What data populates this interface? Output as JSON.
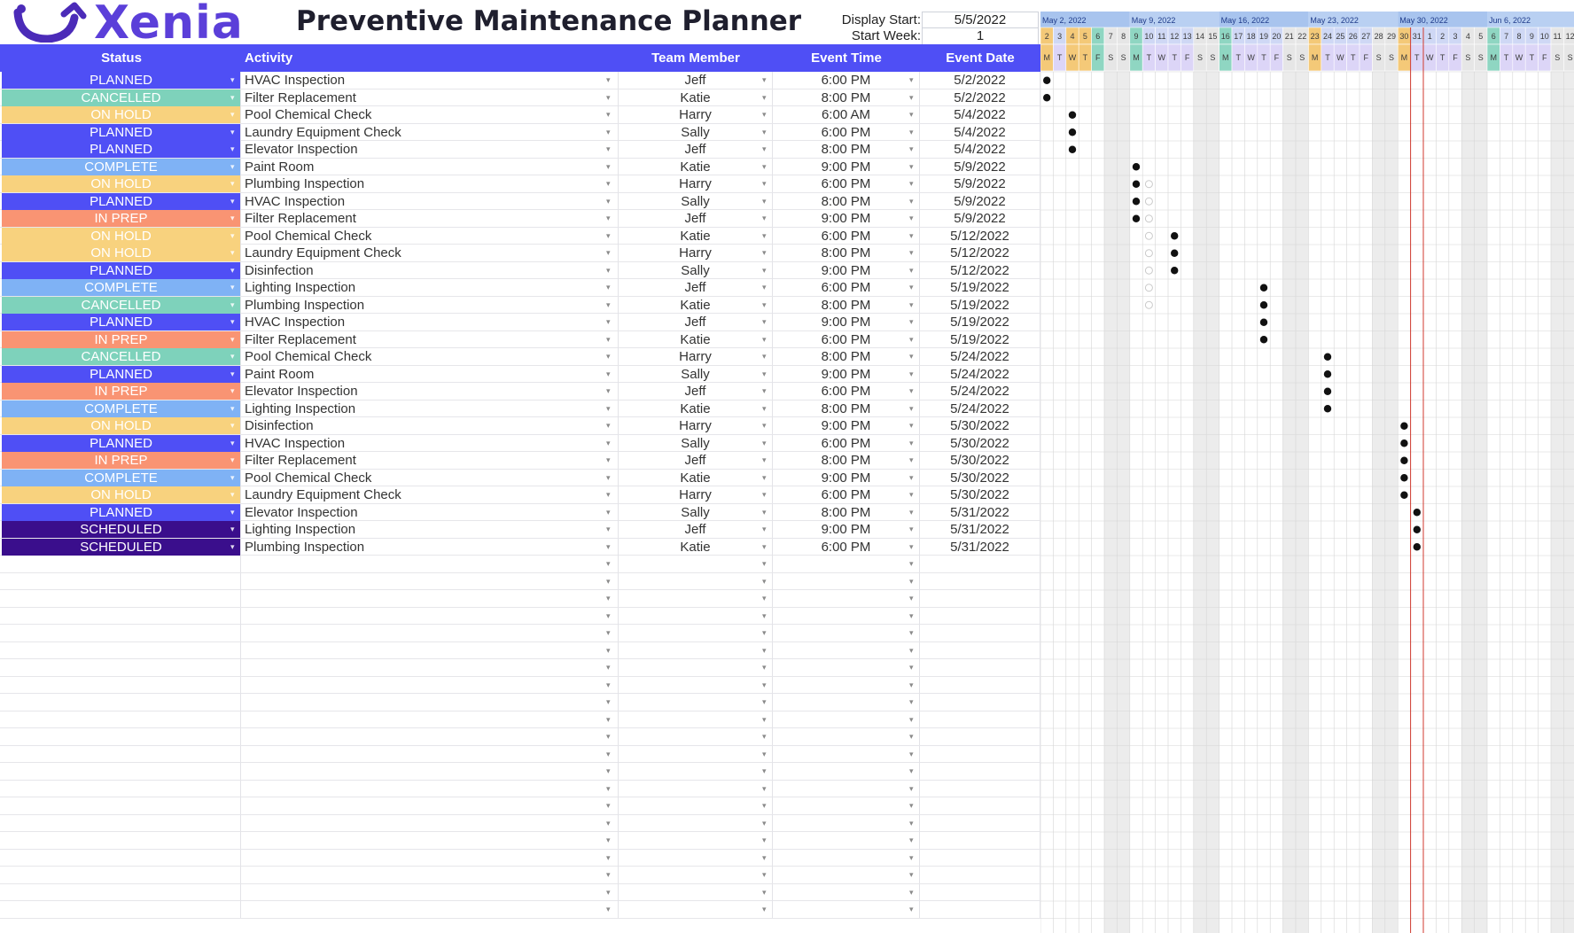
{
  "app": {
    "brand": "Xenia",
    "title": "Preventive Maintenance Planner",
    "display_start_label": "Display Start:",
    "display_start_value": "5/5/2022",
    "start_week_label": "Start Week:",
    "start_week_value": "1"
  },
  "columns": {
    "status": "Status",
    "activity": "Activity",
    "team_member": "Team Member",
    "event_time": "Event Time",
    "event_date": "Event Date"
  },
  "status_colors": {
    "PLANNED": "#4f4ff5",
    "CANCELLED": "#7ed2bb",
    "ON HOLD": "#f8d27e",
    "COMPLETE": "#7fb2f5",
    "IN PREP": "#f99473",
    "SCHEDULED": "#3a0e8c"
  },
  "rows": [
    {
      "status": "PLANNED",
      "activity": "HVAC Inspection",
      "member": "Jeff",
      "time": "6:00 PM",
      "date": "5/2/2022"
    },
    {
      "status": "CANCELLED",
      "activity": "Filter Replacement",
      "member": "Katie",
      "time": "8:00 PM",
      "date": "5/2/2022"
    },
    {
      "status": "ON HOLD",
      "activity": "Pool Chemical Check",
      "member": "Harry",
      "time": "6:00 AM",
      "date": "5/4/2022"
    },
    {
      "status": "PLANNED",
      "activity": "Laundry Equipment Check",
      "member": "Sally",
      "time": "6:00 PM",
      "date": "5/4/2022"
    },
    {
      "status": "PLANNED",
      "activity": "Elevator Inspection",
      "member": "Jeff",
      "time": "8:00 PM",
      "date": "5/4/2022"
    },
    {
      "status": "COMPLETE",
      "activity": "Paint Room",
      "member": "Katie",
      "time": "9:00 PM",
      "date": "5/9/2022"
    },
    {
      "status": "ON HOLD",
      "activity": "Plumbing Inspection",
      "member": "Harry",
      "time": "6:00 PM",
      "date": "5/9/2022"
    },
    {
      "status": "PLANNED",
      "activity": "HVAC Inspection",
      "member": "Sally",
      "time": "8:00 PM",
      "date": "5/9/2022"
    },
    {
      "status": "IN PREP",
      "activity": "Filter Replacement",
      "member": "Jeff",
      "time": "9:00 PM",
      "date": "5/9/2022"
    },
    {
      "status": "ON HOLD",
      "activity": "Pool Chemical Check",
      "member": "Katie",
      "time": "6:00 PM",
      "date": "5/12/2022"
    },
    {
      "status": "ON HOLD",
      "activity": "Laundry Equipment Check",
      "member": "Harry",
      "time": "8:00 PM",
      "date": "5/12/2022"
    },
    {
      "status": "PLANNED",
      "activity": "Disinfection",
      "member": "Sally",
      "time": "9:00 PM",
      "date": "5/12/2022"
    },
    {
      "status": "COMPLETE",
      "activity": "Lighting Inspection",
      "member": "Jeff",
      "time": "6:00 PM",
      "date": "5/19/2022"
    },
    {
      "status": "CANCELLED",
      "activity": "Plumbing Inspection",
      "member": "Katie",
      "time": "8:00 PM",
      "date": "5/19/2022"
    },
    {
      "status": "PLANNED",
      "activity": "HVAC Inspection",
      "member": "Jeff",
      "time": "9:00 PM",
      "date": "5/19/2022"
    },
    {
      "status": "IN PREP",
      "activity": "Filter Replacement",
      "member": "Katie",
      "time": "6:00 PM",
      "date": "5/19/2022"
    },
    {
      "status": "CANCELLED",
      "activity": "Pool Chemical Check",
      "member": "Harry",
      "time": "8:00 PM",
      "date": "5/24/2022"
    },
    {
      "status": "PLANNED",
      "activity": "Paint Room",
      "member": "Sally",
      "time": "9:00 PM",
      "date": "5/24/2022"
    },
    {
      "status": "IN PREP",
      "activity": "Elevator Inspection",
      "member": "Jeff",
      "time": "6:00 PM",
      "date": "5/24/2022"
    },
    {
      "status": "COMPLETE",
      "activity": "Lighting Inspection",
      "member": "Katie",
      "time": "8:00 PM",
      "date": "5/24/2022"
    },
    {
      "status": "ON HOLD",
      "activity": "Disinfection",
      "member": "Harry",
      "time": "9:00 PM",
      "date": "5/30/2022"
    },
    {
      "status": "PLANNED",
      "activity": "HVAC Inspection",
      "member": "Sally",
      "time": "6:00 PM",
      "date": "5/30/2022"
    },
    {
      "status": "IN PREP",
      "activity": "Filter Replacement",
      "member": "Jeff",
      "time": "8:00 PM",
      "date": "5/30/2022"
    },
    {
      "status": "COMPLETE",
      "activity": "Pool Chemical Check",
      "member": "Katie",
      "time": "9:00 PM",
      "date": "5/30/2022"
    },
    {
      "status": "ON HOLD",
      "activity": "Laundry Equipment Check",
      "member": "Harry",
      "time": "6:00 PM",
      "date": "5/30/2022"
    },
    {
      "status": "PLANNED",
      "activity": "Elevator Inspection",
      "member": "Sally",
      "time": "8:00 PM",
      "date": "5/31/2022"
    },
    {
      "status": "SCHEDULED",
      "activity": "Lighting Inspection",
      "member": "Jeff",
      "time": "9:00 PM",
      "date": "5/31/2022"
    },
    {
      "status": "SCHEDULED",
      "activity": "Plumbing Inspection",
      "member": "Katie",
      "time": "6:00 PM",
      "date": "5/31/2022"
    }
  ],
  "gantt": {
    "weeks": [
      "May 2, 2022",
      "May 9, 2022",
      "May 16, 2022",
      "May 23, 2022",
      "May 30, 2022",
      "Jun 6, 2022"
    ],
    "day_numbers": [
      "2",
      "3",
      "4",
      "5",
      "6",
      "7",
      "8",
      "9",
      "10",
      "11",
      "12",
      "13",
      "14",
      "15",
      "16",
      "17",
      "18",
      "19",
      "20",
      "21",
      "22",
      "23",
      "24",
      "25",
      "26",
      "27",
      "28",
      "29",
      "30",
      "31",
      "1",
      "2",
      "3",
      "4",
      "5",
      "6",
      "7",
      "8",
      "9",
      "10",
      "11",
      "12"
    ],
    "day_letters": [
      "M",
      "T",
      "W",
      "T",
      "F",
      "S",
      "S",
      "M",
      "T",
      "W",
      "T",
      "F",
      "S",
      "S",
      "M",
      "T",
      "W",
      "T",
      "F",
      "S",
      "S",
      "M",
      "T",
      "W",
      "T",
      "F",
      "S",
      "S",
      "M",
      "T",
      "W",
      "T",
      "F",
      "S",
      "S",
      "M",
      "T",
      "W",
      "T",
      "F",
      "S",
      "S"
    ],
    "today_marker_date": "5/31/2022",
    "colors": {
      "week_header": "#a8c4ee",
      "week_header_alt": "#b9d0f2",
      "weekday_cell": "#cfd8f5",
      "weekday_letter_bg": "#dcd5f7",
      "weekend_cell": "#ececec",
      "highlight_day": "#f4c978",
      "highlight_green": "#8fd6c2",
      "today_line": "#d03a2f",
      "grid": "#d6d6d6"
    }
  }
}
